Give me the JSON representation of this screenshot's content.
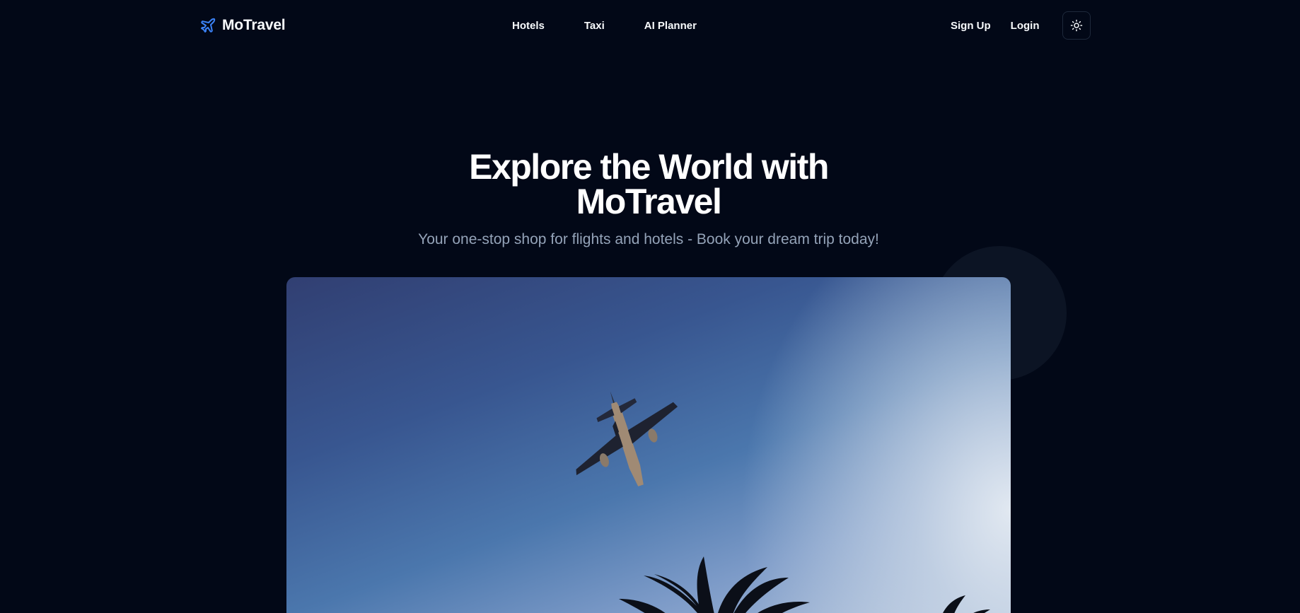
{
  "brand": {
    "name": "MoTravel",
    "icon": "plane-icon",
    "accent": "#3b82f6"
  },
  "nav": {
    "items": [
      {
        "label": "Hotels"
      },
      {
        "label": "Taxi"
      },
      {
        "label": "AI Planner"
      }
    ]
  },
  "auth": {
    "signup_label": "Sign Up",
    "login_label": "Login",
    "theme_icon": "sun-icon"
  },
  "hero": {
    "title_line1": "Explore the World with",
    "title_line2": "MoTravel",
    "subtitle": "Your one-stop shop for flights and hotels - Book your dream trip today!"
  },
  "colors": {
    "background": "#020817",
    "text": "#f8fafc",
    "muted": "#94a3b8"
  }
}
